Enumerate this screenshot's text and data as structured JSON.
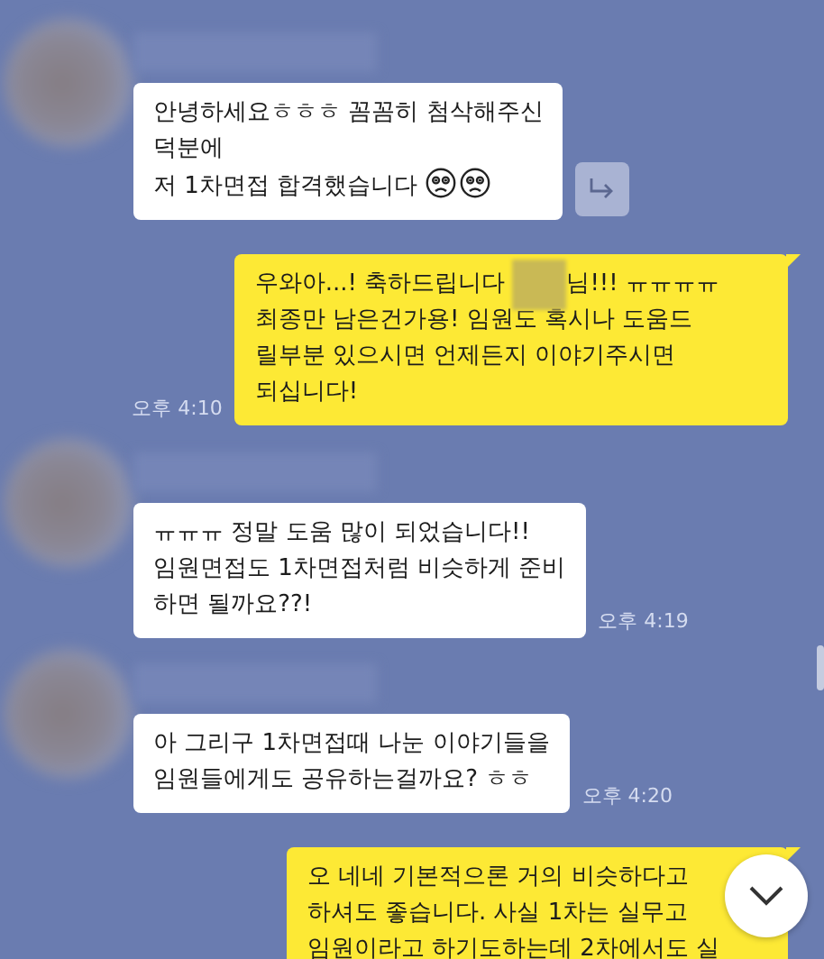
{
  "messages": [
    {
      "kind": "incoming",
      "avatar": true,
      "share": true,
      "segments": [
        {
          "kind": "text",
          "text": "안녕하세요ㅎㅎㅎ 꼼꼼히 첨삭해주신\n덕분에\n저 1차면접 합격했습니다 "
        },
        {
          "kind": "sad-face"
        },
        {
          "kind": "sad-face"
        }
      ]
    },
    {
      "kind": "outgoing",
      "time": "오후 4:10",
      "segments": [
        {
          "kind": "text",
          "text": "우와아...! 축하드립니다 "
        },
        {
          "kind": "redacted"
        },
        {
          "kind": "text",
          "text": "님!!! ㅠㅠㅠㅠ\n최종만 남은건가용! 임원도 혹시나 도움드\n릴부분 있으시면 언제든지 이야기주시면\n되십니다!"
        }
      ]
    },
    {
      "kind": "incoming",
      "avatar": true,
      "time": "오후 4:19",
      "segments": [
        {
          "kind": "text",
          "text": "ㅠㅠㅠ 정말 도움 많이 되었습니다!!\n임원면접도 1차면접처럼 비슷하게 준비\n하면 될까요??!"
        }
      ]
    },
    {
      "kind": "incoming",
      "avatar": true,
      "time": "오후 4:20",
      "segments": [
        {
          "kind": "text",
          "text": "아 그리구 1차면접때 나눈 이야기들을\n임원들에게도 공유하는걸까요? ㅎㅎ"
        }
      ]
    },
    {
      "kind": "outgoing",
      "segments": [
        {
          "kind": "text",
          "text": "오 네네 기본적으론 거의 비슷하다고\n하셔도 좋습니다. 사실 1차는 실무고\n임원이라고 하기도하는데 2차에서도 실"
        }
      ]
    }
  ]
}
